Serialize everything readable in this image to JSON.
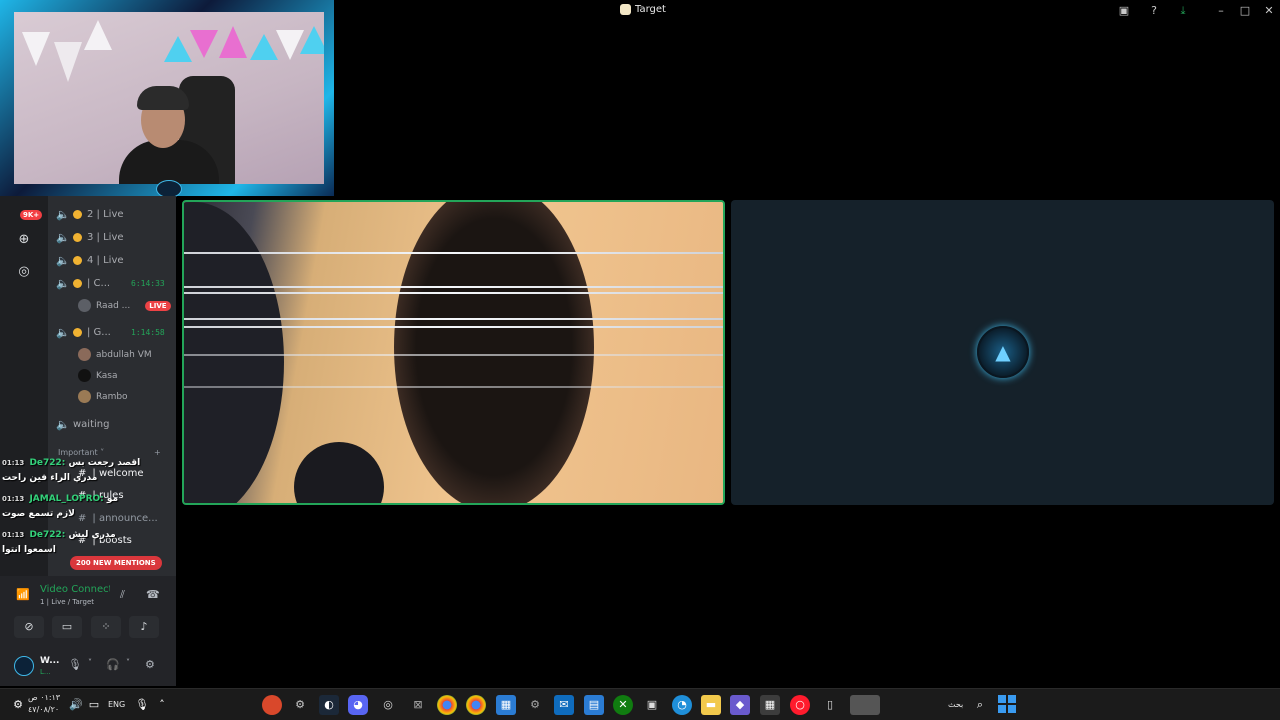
{
  "window": {
    "title": "Target"
  },
  "titlebar_buttons": [
    "cast-icon",
    "help-icon",
    "download-icon",
    "minimize-icon",
    "maximize-icon",
    "close-icon"
  ],
  "server_rail": {
    "badge": "9K+"
  },
  "voice_channels": [
    {
      "name": "2 | Live"
    },
    {
      "name": "3 | Live"
    },
    {
      "name": "4 | Live"
    },
    {
      "name": "| C...",
      "timer": "6:14:33",
      "active": true
    },
    {
      "name": "| G...",
      "timer": "1:14:58",
      "active": true
    },
    {
      "name": "waiting"
    }
  ],
  "channel_users": [
    {
      "name": "Raad ...",
      "live": "LIVE"
    },
    {
      "name": "abdullah VM"
    },
    {
      "name": "Kasa"
    },
    {
      "name": "Rambo"
    }
  ],
  "category": {
    "label": "Important",
    "add": "+"
  },
  "text_channels": [
    {
      "name": "| welcome"
    },
    {
      "name": "| rules"
    },
    {
      "name": "| announce..."
    },
    {
      "name": "| boosts"
    }
  ],
  "mentions_pill": "200 NEW MENTIONS",
  "chat_overlay": [
    {
      "time": "01:13",
      "user": "De722:",
      "text": "اقصد رجعت بس"
    },
    {
      "time": "",
      "user": "",
      "text": "مدري الراء فين راحت"
    },
    {
      "time": "01:13",
      "user": "JAMAL_LOPRO:",
      "text": "مو"
    },
    {
      "time": "",
      "user": "",
      "text": "لازم تسمع صوت"
    },
    {
      "time": "01:13",
      "user": "De722:",
      "text": "مدري ليش"
    },
    {
      "time": "",
      "user": "",
      "text": "اسمعوا انتوا"
    }
  ],
  "voice_panel": {
    "title": "Video Connected",
    "subtitle": "1 | Live / Target"
  },
  "user_panel": {
    "name": "W...",
    "status": "L..."
  },
  "taskbar": {
    "time": "٠١:١٣ ص",
    "date": "٤٧/٠٨/٢٠",
    "language": "ENG",
    "search_label": "بحث"
  },
  "colors": {
    "accent_green": "#23a559",
    "mention_red": "#da373c",
    "live_red": "#ed4245",
    "brand_blue": "#3fb8e8"
  }
}
